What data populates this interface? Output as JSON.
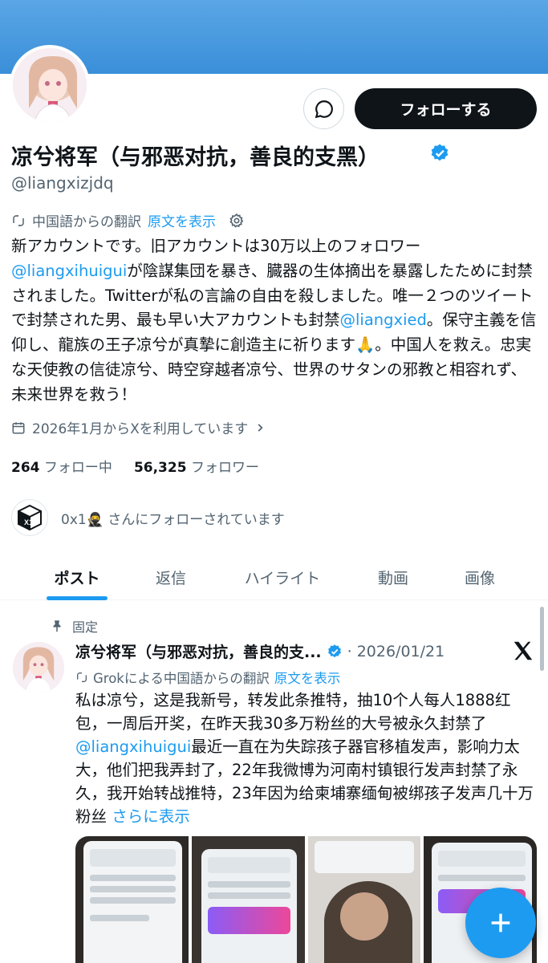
{
  "profile": {
    "display_name": "凉兮将军（与邪恶对抗，善良的支黑）",
    "handle": "@liangxizjdq",
    "follow_label": "フォローする",
    "translate_note": "中国語からの翻訳",
    "show_original": "原文を表示",
    "bio": {
      "p1": "新アカウントです。旧アカウントは30万以上のフォロワー",
      "mention1": "@liangxihuigui",
      "p2": "が陰謀集団を暴き、臓器の生体摘出を暴露したために封禁されました。Twitterが私の言論の自由を殺しました。唯一２つのツイートで封禁された男、最も早い大アカウントも封禁",
      "mention2": "@liangxied",
      "p3": "。保守主義を信仰し、龍族の王子凉兮が真摯に創造主に祈ります🙏。中国人を救え。忠実な天使教の信徒凉兮、時空穿越者凉兮、世界のサタンの邪教と相容れず、未来世界を救う！"
    },
    "joined": "2026年1月からXを利用しています",
    "following_count": "264",
    "following_label": "フォロー中",
    "followers_count": "56,325",
    "followers_label": "フォロワー",
    "followed_by": "0x1🥷 さんにフォローされています",
    "mini_avatar_text": "X1"
  },
  "tabs": [
    {
      "label": "ポスト"
    },
    {
      "label": "返信"
    },
    {
      "label": "ハイライト"
    },
    {
      "label": "動画"
    },
    {
      "label": "画像"
    }
  ],
  "post": {
    "pinned_label": "固定",
    "name": "凉兮将军（与邪恶对抗，善良的支...",
    "date": "2026/01/21",
    "translate_note": "Grokによる中国語からの翻訳",
    "show_original": "原文を表示",
    "body1": "私は凉兮，这是我新号，转发此条推特，抽10个人每人1888红包，一周后开奖，在昨天我30多万粉丝的大号被永久封禁了",
    "mention": "@liangxihuigui",
    "body2": "最近一直在为失踪孩子器官移植发声，影响力太大，他们把我弄封了，22年我微博为河南村镇银行发声封禁了永久，我开始转战推特，23年因为给柬埔寨缅甸被绑孩子发声几十万粉丝",
    "more": "さらに表示"
  },
  "colors": {
    "accent": "#1d9bf0",
    "banner": "#4a9be0",
    "text": "#0f1419",
    "secondary": "#536471"
  }
}
